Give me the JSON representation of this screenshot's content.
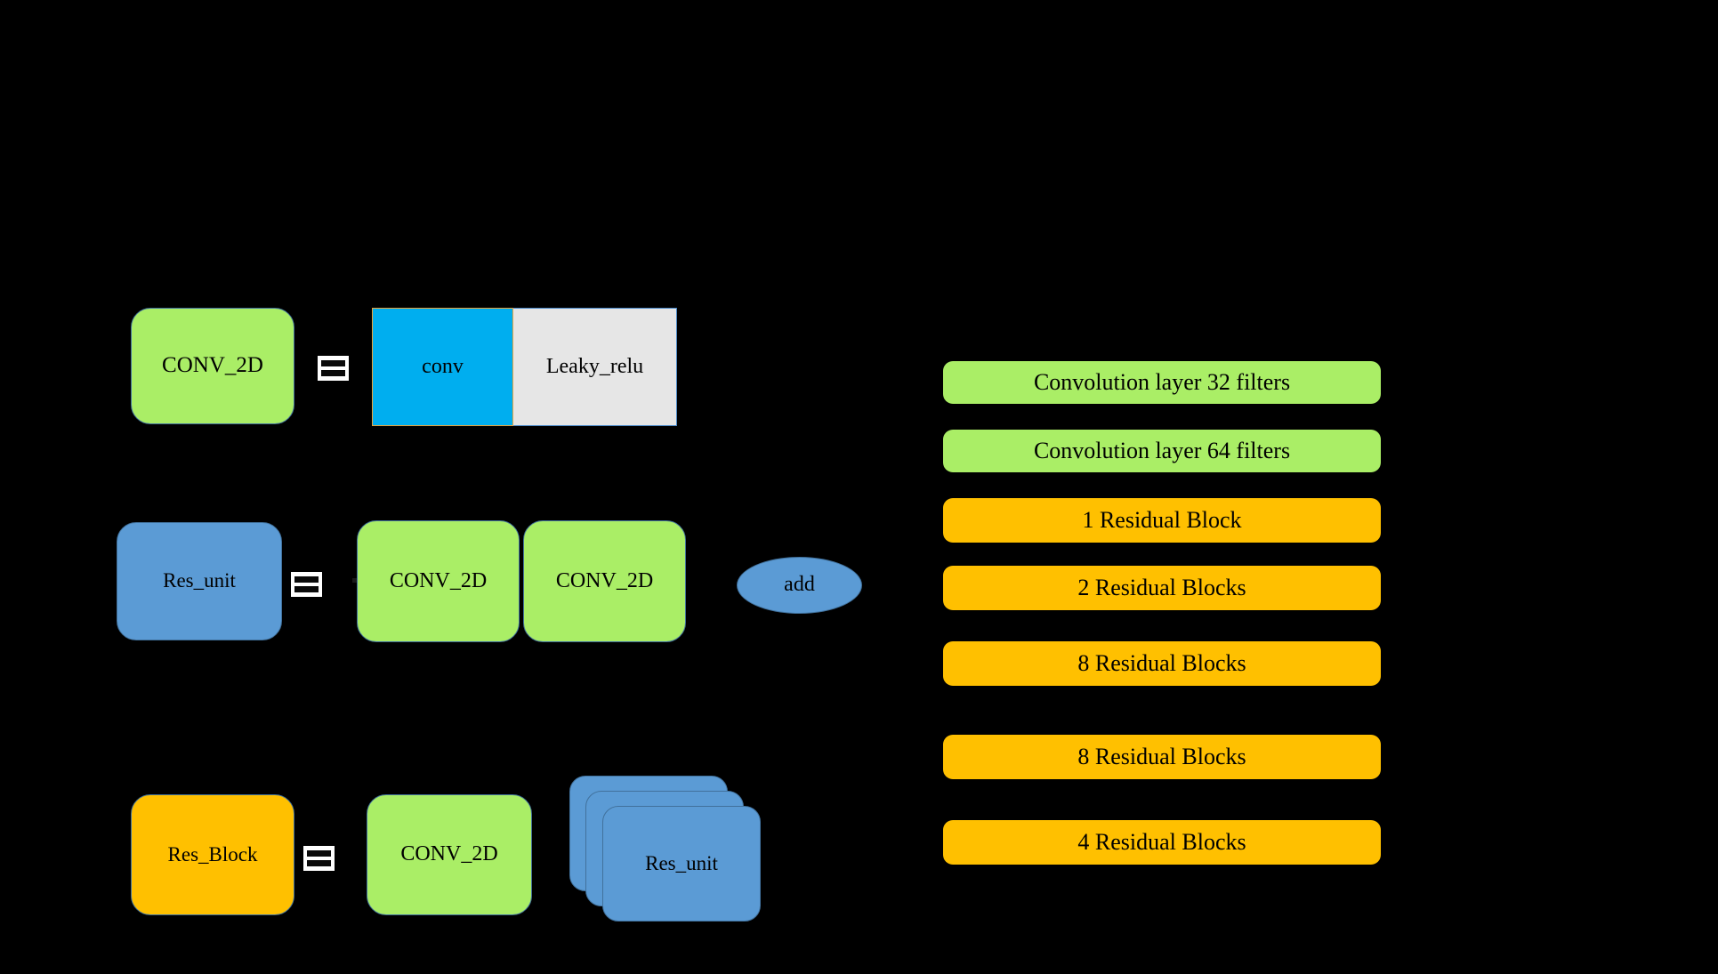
{
  "diagram": {
    "background_color": "#000000",
    "legend_rows": [
      {
        "id": "conv2d",
        "lhs_label": "CONV_2D",
        "lhs_color": "#AAEE66",
        "operator": "equals-icon",
        "rhs_parts": [
          {
            "label": "conv",
            "color": "#00AEEF"
          },
          {
            "label": "Leaky_relu",
            "color": "#E6E6E6"
          }
        ]
      },
      {
        "id": "res_unit",
        "lhs_label": "Res_unit",
        "lhs_color": "#5B9BD5",
        "operator": "equals-icon",
        "rhs_parts": [
          {
            "label": "CONV_2D",
            "color": "#AAEE66"
          },
          {
            "label": "CONV_2D",
            "color": "#AAEE66"
          },
          {
            "label": "add",
            "color": "#5B9BD5"
          }
        ]
      },
      {
        "id": "res_block",
        "lhs_label": "Res_Block",
        "lhs_color": "#FFC000",
        "operator": "equals-icon",
        "rhs_parts": [
          {
            "label": "CONV_2D",
            "color": "#AAEE66"
          },
          {
            "label": "Res_unit",
            "color": "#5B9BD5"
          }
        ]
      }
    ],
    "row1": {
      "lhs": "CONV_2D",
      "conv": "conv",
      "leaky_relu": "Leaky_relu"
    },
    "row2": {
      "lhs": "Res_unit",
      "conv_a": "CONV_2D",
      "conv_b": "CONV_2D",
      "add": "add"
    },
    "row3": {
      "lhs": "Res_Block",
      "conv": "CONV_2D",
      "res_unit": "Res_unit"
    },
    "stack": {
      "stacked_card_count": 3
    },
    "network_stack": {
      "items": [
        {
          "label": "Convolution layer 32 filters",
          "color": "#AAEE66",
          "kind": "conv"
        },
        {
          "label": "Convolution layer 64 filters",
          "color": "#AAEE66",
          "kind": "conv"
        },
        {
          "label": "1 Residual Block",
          "color": "#FFC000",
          "kind": "residual"
        },
        {
          "label": "2 Residual Blocks",
          "color": "#FFC000",
          "kind": "residual"
        },
        {
          "label": "8 Residual Blocks",
          "color": "#FFC000",
          "kind": "residual"
        },
        {
          "label": "8 Residual Blocks",
          "color": "#FFC000",
          "kind": "residual"
        },
        {
          "label": "4 Residual Blocks",
          "color": "#FFC000",
          "kind": "residual"
        }
      ]
    },
    "colors": {
      "green": "#AAEE66",
      "blue": "#5B9BD5",
      "orange": "#FFC000",
      "cyan": "#00AEEF",
      "gray": "#E6E6E6",
      "border_blue": "#41719C",
      "border_orange": "#E8A33D",
      "background": "#000000",
      "equals_icon_fill": "#FFFFFF",
      "equals_icon_bar": "#0A0A0A"
    }
  }
}
